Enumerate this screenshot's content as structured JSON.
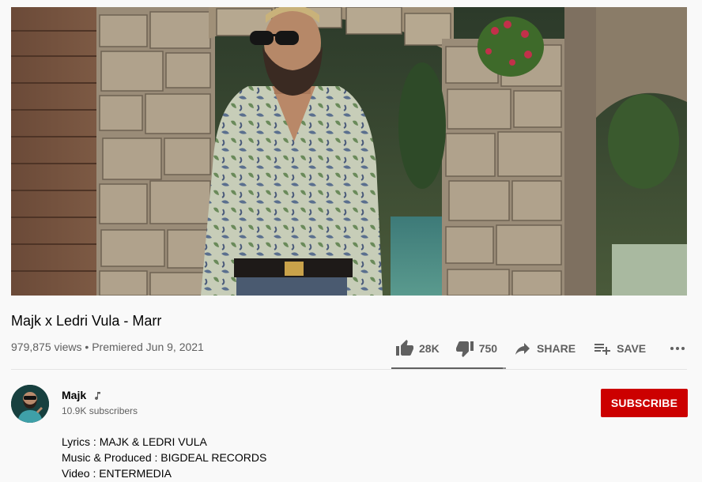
{
  "video": {
    "title": "Majk x Ledri Vula - Marr",
    "views": "979,875 views",
    "separator": "•",
    "premiered": "Premiered Jun 9, 2021"
  },
  "actions": {
    "like_count": "28K",
    "dislike_count": "750",
    "share_label": "SHARE",
    "save_label": "SAVE",
    "like_ratio": 0.974
  },
  "channel": {
    "name": "Majk",
    "subscribers": "10.9K subscribers",
    "subscribe_label": "SUBSCRIBE"
  },
  "description": {
    "lines": [
      "Lyrics : MAJK & LEDRI VULA",
      "Music & Produced : BIGDEAL RECORDS",
      "Video : ENTERMEDIA"
    ]
  },
  "colors": {
    "subscribe_bg": "#cc0000",
    "icon_gray": "#606060"
  },
  "icons": [
    "thumb-up-icon",
    "thumb-down-icon",
    "share-icon",
    "save-playlist-icon",
    "more-horiz-icon",
    "music-note-icon"
  ]
}
